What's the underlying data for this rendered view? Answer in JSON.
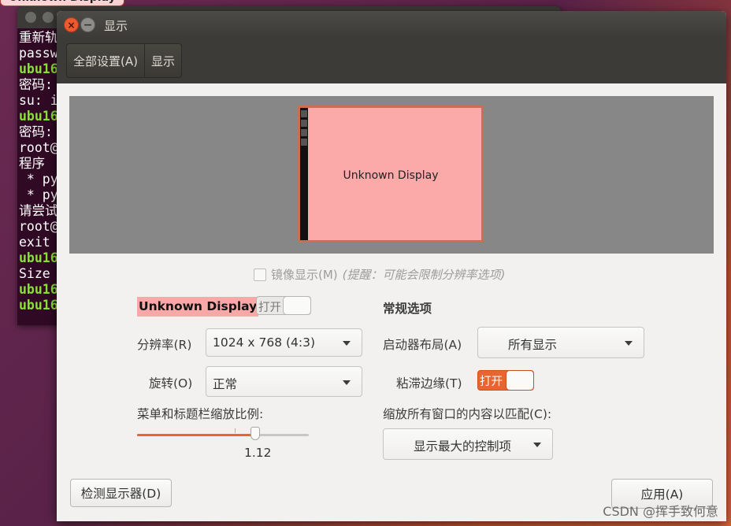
{
  "tooltip": {
    "text": "Unknown Display"
  },
  "terminal": {
    "lines": [
      {
        "text": "重新轨",
        "green": false
      },
      {
        "text": "passw",
        "green": false
      },
      {
        "text": "ubu16",
        "green": true
      },
      {
        "text": "密码:",
        "green": false
      },
      {
        "text": "su: i",
        "green": false
      },
      {
        "text": "ubu16",
        "green": true
      },
      {
        "text": "密码:",
        "green": false
      },
      {
        "text": "root@",
        "green": false
      },
      {
        "text": "程序",
        "green": false
      },
      {
        "text": " * py",
        "green": false
      },
      {
        "text": " * py",
        "green": false
      },
      {
        "text": "请尝试",
        "green": false
      },
      {
        "text": "root@",
        "green": false
      },
      {
        "text": "exit",
        "green": false
      },
      {
        "text": "ubu16",
        "green": true
      },
      {
        "text": "Size",
        "green": false
      },
      {
        "text": "ubu16",
        "green": true
      },
      {
        "text": "ubu16",
        "green": true
      }
    ]
  },
  "window": {
    "title": "显示",
    "close_glyph": "×",
    "minimize_glyph": "−"
  },
  "toolbar": {
    "all_settings": "全部设置(A)",
    "current": "显示"
  },
  "preview": {
    "monitor_label": "Unknown Display"
  },
  "mirror": {
    "label": "镜像显示(M)",
    "hint": "(提醒：可能会限制分辨率选项)",
    "checked": false
  },
  "display": {
    "name": "Unknown Display",
    "toggle_label": "打开",
    "enabled": false,
    "resolution_label": "分辨率(R)",
    "resolution_value": "1024 x 768 (4:3)",
    "rotation_label": "旋转(O)",
    "rotation_value": "正常",
    "scale_label": "菜单和标题栏缩放比例:",
    "scale_value": "1.12",
    "scale_fraction": 0.69
  },
  "general": {
    "heading": "常规选项",
    "launcher_label": "启动器布局(A)",
    "launcher_value": "所有显示",
    "sticky_label": "粘滞边缘(T)",
    "sticky_toggle_label": "打开",
    "sticky_enabled": true,
    "fit_label": "缩放所有窗口的内容以匹配(C):",
    "fit_value": "显示最大的控制项"
  },
  "buttons": {
    "detect": "检测显示器(D)",
    "apply": "应用(A)"
  },
  "colors": {
    "accent": "#e9642f",
    "monitor_fill": "#fba9a9",
    "preview_bg": "#878787"
  },
  "watermark": "CSDN @挥手致何意"
}
